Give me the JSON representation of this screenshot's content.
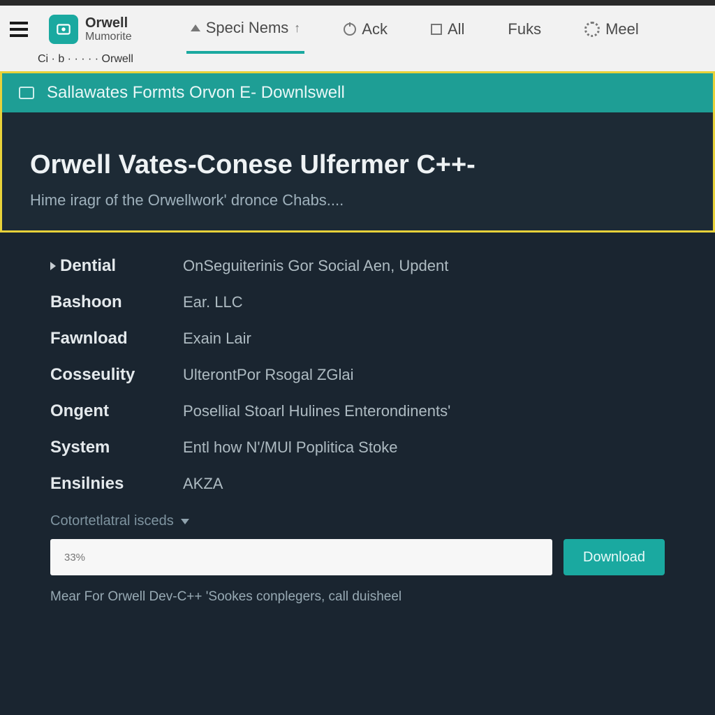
{
  "brand": {
    "line1": "Orwell",
    "line2": "Mumorite"
  },
  "nav": {
    "items": [
      {
        "label": "Speci Nems",
        "icon": "sort"
      },
      {
        "label": "Ack",
        "icon": "clock"
      },
      {
        "label": "All",
        "icon": "square"
      },
      {
        "label": "Fuks",
        "icon": "none"
      },
      {
        "label": "Meel",
        "icon": "gear"
      }
    ]
  },
  "overlap_text": "Ci · b · · · · · Orwell",
  "banner": {
    "title": "Sallawates Formts Orvon E- Downlswell"
  },
  "hero": {
    "title": "Orwell Vates-Conese Ulfermer C++-",
    "subtitle": "Hime iragr of the Orwellwork' dronce Chabs...."
  },
  "details": {
    "rows": [
      {
        "key": "Dential",
        "val": "OnSeguiterinis Gor Social Aen, Updent",
        "caret": true
      },
      {
        "key": "Bashoon",
        "val": "Ear. LLC",
        "caret": false
      },
      {
        "key": "Fawnload",
        "val": "Exain Lair",
        "caret": false
      },
      {
        "key": "Cosseulity",
        "val": "UlterontPor Rsogal ZGlai",
        "caret": false
      },
      {
        "key": "Ongent",
        "val": "Posellial Stoarl Hulines Enterondinents'",
        "caret": false
      },
      {
        "key": "System",
        "val": "Entl how N'/MUl Poplitica Stoke",
        "caret": false
      },
      {
        "key": "Ensilnies",
        "val": "AKZA",
        "caret": false
      }
    ]
  },
  "dropdown_label": "Cotortetlatral isceds",
  "input": {
    "placeholder": "33%"
  },
  "download_label": "Download",
  "footnote": "Mear For Orwell Dev-C++ 'Sookes conplegers, call duisheel",
  "colors": {
    "accent": "#1aa9a0",
    "highlight": "#e8d23a",
    "bg": "#1d2a35"
  }
}
